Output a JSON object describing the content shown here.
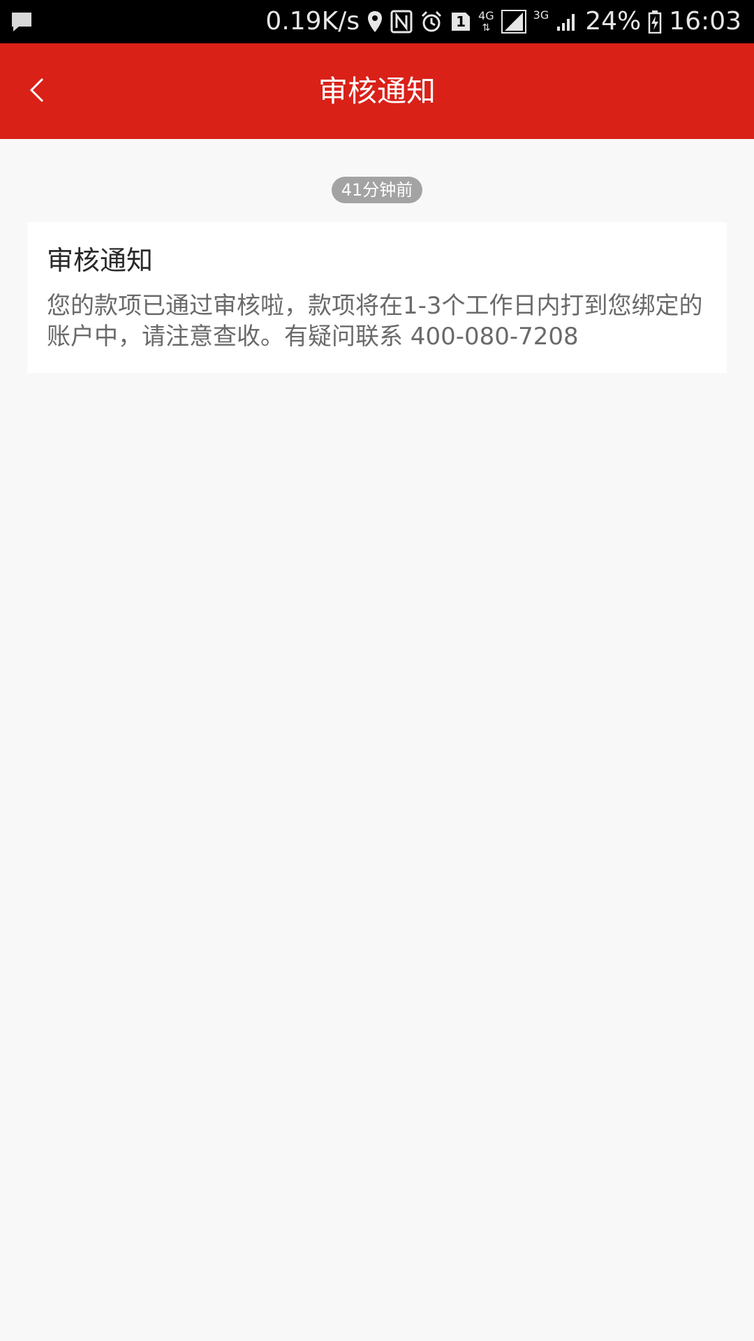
{
  "status_bar": {
    "notification_icon": "message-icon",
    "net_speed": "0.19K/s",
    "icons": [
      "location-icon",
      "nfc-icon",
      "alarm-icon",
      "sim1-icon",
      "4g-icon",
      "signal-icon",
      "3g-icon",
      "signal-icon"
    ],
    "sim_label": "1",
    "net_4g": "4G",
    "net_3g": "3G",
    "battery": "24%",
    "battery_icon": "battery-charging-icon",
    "time": "16:03"
  },
  "header": {
    "back_icon": "chevron-left-icon",
    "title": "审核通知",
    "bg_color": "#d92118"
  },
  "message": {
    "time_ago": "41分钟前",
    "title": "审核通知",
    "body": "您的款项已通过审核啦，款项将在1-3个工作日内打到您绑定的账户中，请注意查收。有疑问联系 400-080-7208"
  }
}
